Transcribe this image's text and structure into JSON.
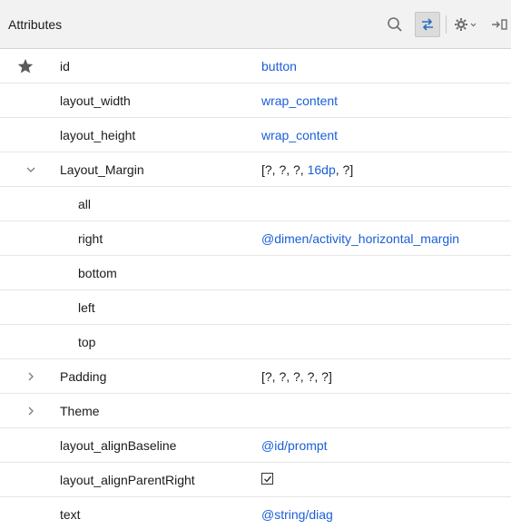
{
  "header": {
    "title": "Attributes"
  },
  "toolbar": {
    "search_icon": "search-icon",
    "swap_icon": "swap-arrows-icon",
    "settings_icon": "gear-dropdown-icon",
    "pin_icon": "pin-right-icon"
  },
  "colors": {
    "link_value": "#1a5fd8",
    "header_bg": "#f2f2f2",
    "row_divider": "#e6e6e6"
  },
  "rows": [
    {
      "name": "id",
      "value": "button",
      "starred": true
    },
    {
      "name": "layout_width",
      "value": "wrap_content"
    },
    {
      "name": "layout_height",
      "value": "wrap_content"
    },
    {
      "name": "Layout_Margin",
      "value_prefix": "[?, ?, ?, ",
      "value_highlight": "16dp",
      "value_suffix": ", ?]",
      "expanded": true
    },
    {
      "name": "all",
      "value": ""
    },
    {
      "name": "right",
      "value": "@dimen/activity_horizontal_margin"
    },
    {
      "name": "bottom",
      "value": ""
    },
    {
      "name": "left",
      "value": ""
    },
    {
      "name": "top",
      "value": ""
    },
    {
      "name": "Padding",
      "value": "[?, ?, ?, ?, ?]",
      "expanded": false
    },
    {
      "name": "Theme",
      "value": "",
      "expanded": false
    },
    {
      "name": "layout_alignBaseline",
      "value": "@id/prompt"
    },
    {
      "name": "layout_alignParentRight",
      "checked": true
    },
    {
      "name": "text",
      "value": "@string/diag"
    }
  ]
}
